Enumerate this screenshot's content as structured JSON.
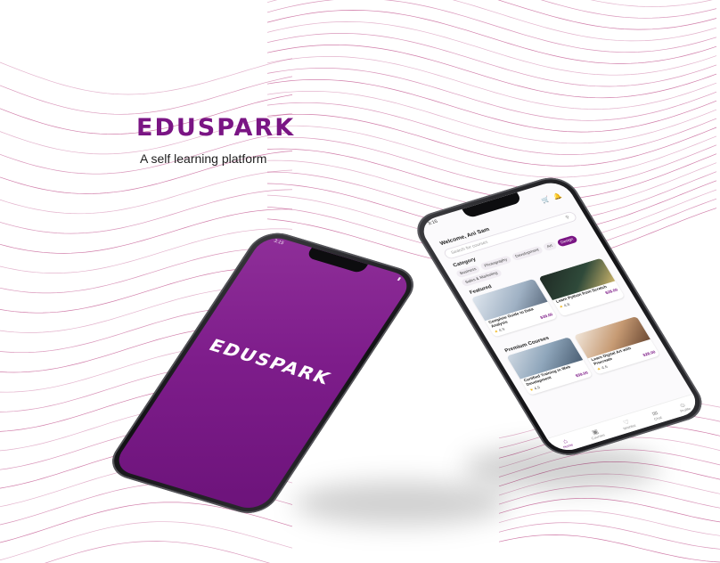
{
  "brand": {
    "name": "EDUSPARK",
    "tagline": "A self learning platform",
    "accent_color": "#7a1584",
    "wave_color": "#b0236e"
  },
  "splash_phone": {
    "logo_text": "EDUSPARK",
    "time": "3:15",
    "battery_icon": "battery-icon"
  },
  "app_phone": {
    "time": "3:16",
    "greeting": "Welcome, Ani Sam",
    "icons": [
      "cart-icon",
      "bell-icon"
    ],
    "search_placeholder": "Search for courses",
    "categories_heading": "Category",
    "categories": [
      {
        "label": "Business",
        "active": false
      },
      {
        "label": "Photography",
        "active": false
      },
      {
        "label": "Development",
        "active": false
      },
      {
        "label": "Art",
        "active": false
      },
      {
        "label": "Design",
        "active": true
      },
      {
        "label": "Sales & Marketing",
        "active": false
      }
    ],
    "featured_heading": "Featured",
    "featured_cards": [
      {
        "title": "Complete Guide to Data Analysis",
        "price": "$39.00",
        "rating": "4.9",
        "image": "laptop-desk-photo"
      },
      {
        "title": "Learn Python from Scratch",
        "price": "$28.00",
        "rating": "4.8",
        "image": "code-screen-photo"
      }
    ],
    "premium_heading": "Premium Courses",
    "premium_cards": [
      {
        "title": "Certified Training in Web Development",
        "price": "$39.00",
        "rating": "4.9",
        "image": "student-writing-photo"
      },
      {
        "title": "Learn Digital Art with Procreate",
        "price": "$28.00",
        "rating": "4.6",
        "image": "girl-drawing-photo"
      }
    ],
    "nav": [
      {
        "label": "Home",
        "icon": "home-icon",
        "active": true
      },
      {
        "label": "Courses",
        "icon": "courses-icon",
        "active": false
      },
      {
        "label": "Wishlist",
        "icon": "wishlist-icon",
        "active": false
      },
      {
        "label": "Chat",
        "icon": "chat-icon",
        "active": false
      },
      {
        "label": "Profile",
        "icon": "profile-icon",
        "active": false
      }
    ]
  }
}
